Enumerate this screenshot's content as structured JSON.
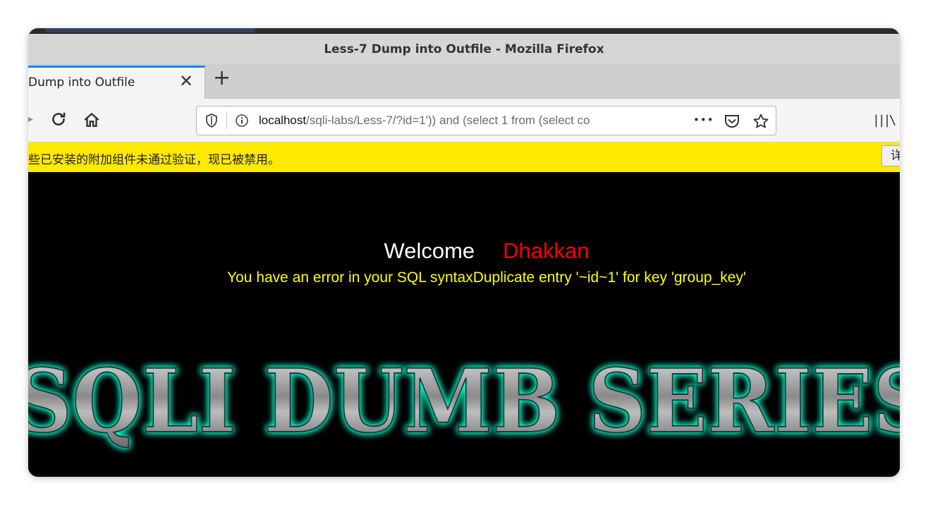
{
  "window": {
    "title": "Less-7 Dump into Outfile - Mozilla Firefox"
  },
  "tab": {
    "title": "Dump into Outfile",
    "close_icon": "close-icon"
  },
  "newtab": {
    "label": "+"
  },
  "nav": {
    "back_icon": "back-arrow-icon",
    "reload_icon": "reload-icon",
    "home_icon": "home-icon",
    "url_host": "localhost",
    "url_rest": "/sqli-labs/Less-7/?id=1')) and (select 1 from (select co",
    "more_label": "•••",
    "library_label": "|||\\"
  },
  "notice": {
    "text": "些已安装的附加组件未通过验证，现已被禁用。",
    "button_label": "详"
  },
  "page": {
    "welcome_label": "Welcome",
    "user_name": "Dhakkan",
    "error_message": "You have an error in your SQL syntaxDuplicate entry '~id~1' for key 'group_key'",
    "banner_text": "SQLI DUMB SERIES"
  },
  "colors": {
    "accent_tab": "#0a84ff",
    "notice_bg": "#ffe900",
    "user_name": "#ff0000",
    "error_text": "#ffff00",
    "banner_glow": "#00ffd0"
  }
}
